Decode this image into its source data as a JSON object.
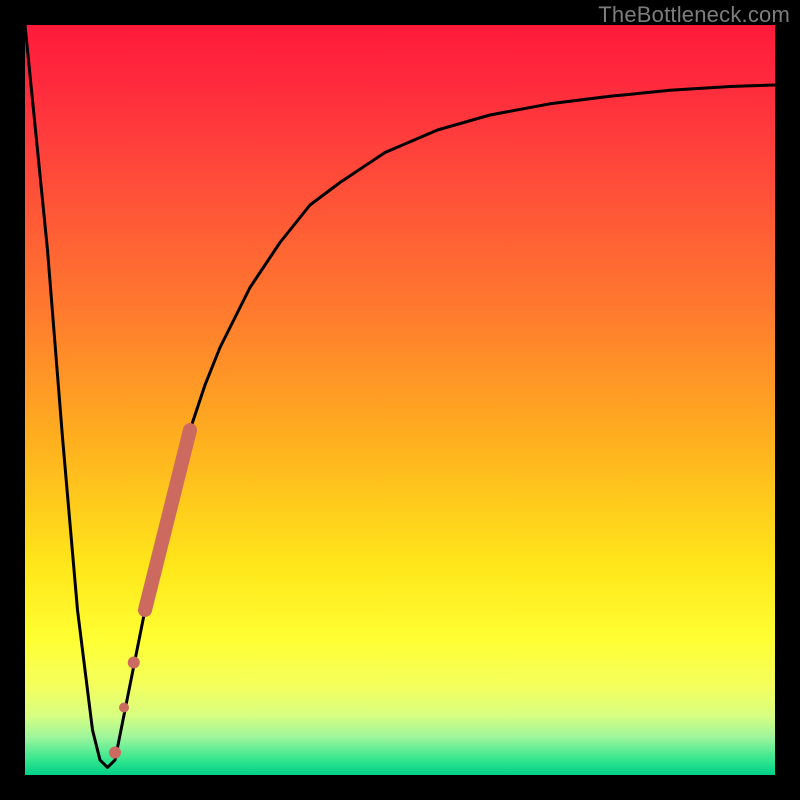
{
  "watermark": "TheBottleneck.com",
  "chart_data": {
    "type": "line",
    "title": "",
    "xlabel": "",
    "ylabel": "",
    "xlim": [
      0,
      100
    ],
    "ylim": [
      0,
      100
    ],
    "grid": false,
    "legend": false,
    "series": [
      {
        "name": "bottleneck-curve",
        "color": "#000000",
        "x": [
          0,
          3,
          5,
          7,
          9,
          10,
          11,
          12,
          14,
          16,
          18,
          20,
          22,
          24,
          26,
          28,
          30,
          34,
          38,
          42,
          48,
          55,
          62,
          70,
          78,
          86,
          94,
          100
        ],
        "values": [
          100,
          70,
          45,
          22,
          6,
          2,
          1,
          2,
          12,
          22,
          31,
          39,
          46,
          52,
          57,
          61,
          65,
          71,
          76,
          79,
          83,
          86,
          88,
          89.5,
          90.5,
          91.3,
          91.8,
          92
        ]
      }
    ],
    "markers": [
      {
        "name": "segment-highlight",
        "shape": "thick-line",
        "color": "#cc6a60",
        "x0": 16,
        "y0": 22,
        "x1": 22,
        "y1": 46,
        "width": 14
      },
      {
        "name": "dot-1",
        "shape": "circle",
        "color": "#cc6a60",
        "x": 14.5,
        "y": 15,
        "r": 6
      },
      {
        "name": "dot-2",
        "shape": "circle",
        "color": "#cc6a60",
        "x": 13.2,
        "y": 9,
        "r": 5
      },
      {
        "name": "dot-3",
        "shape": "circle",
        "color": "#cc6a60",
        "x": 12.0,
        "y": 3,
        "r": 6
      }
    ]
  }
}
